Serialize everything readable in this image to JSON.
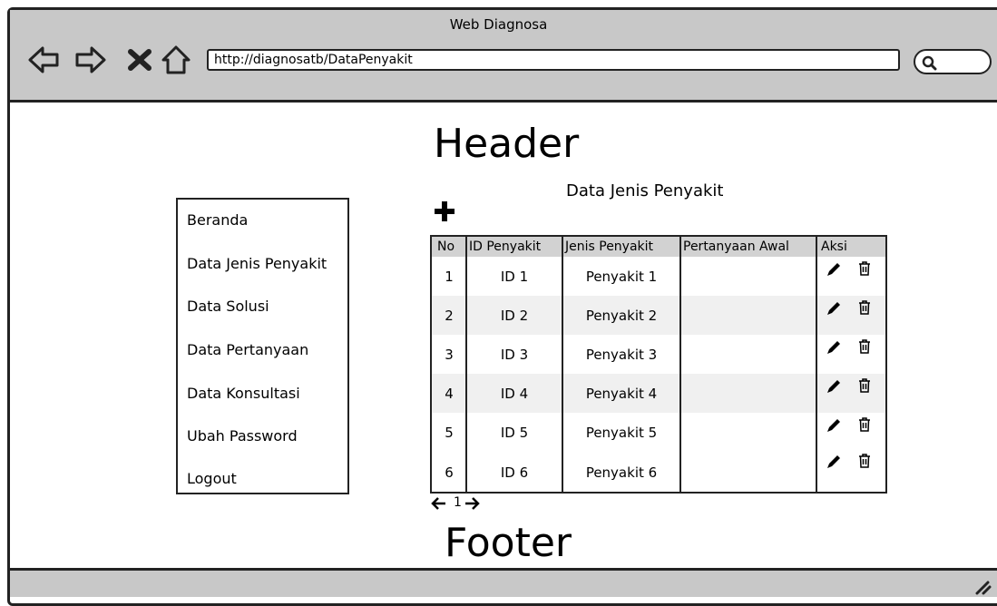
{
  "window": {
    "title": "Web Diagnosa",
    "url": "http://diagnosatb/DataPenyakit"
  },
  "page": {
    "header": "Header",
    "footer": "Footer",
    "section_title": "Data Jenis Penyakit"
  },
  "sidebar": {
    "items": [
      {
        "label": "Beranda"
      },
      {
        "label": "Data Jenis Penyakit"
      },
      {
        "label": "Data Solusi"
      },
      {
        "label": "Data Pertanyaan"
      },
      {
        "label": "Data Konsultasi"
      },
      {
        "label": "Ubah Password"
      },
      {
        "label": "Logout"
      }
    ]
  },
  "table": {
    "columns": [
      "No",
      "ID Penyakit",
      "Jenis Penyakit",
      "Pertanyaan Awal",
      "Aksi"
    ],
    "rows": [
      {
        "no": "1",
        "id": "ID 1",
        "jenis": "Penyakit 1",
        "pertanyaan": ""
      },
      {
        "no": "2",
        "id": "ID 2",
        "jenis": "Penyakit 2",
        "pertanyaan": ""
      },
      {
        "no": "3",
        "id": "ID 3",
        "jenis": "Penyakit 3",
        "pertanyaan": ""
      },
      {
        "no": "4",
        "id": "ID 4",
        "jenis": "Penyakit 4",
        "pertanyaan": ""
      },
      {
        "no": "5",
        "id": "ID 5",
        "jenis": "Penyakit 5",
        "pertanyaan": ""
      },
      {
        "no": "6",
        "id": "ID 6",
        "jenis": "Penyakit 6",
        "pertanyaan": ""
      }
    ],
    "actions": {
      "edit_icon": "pencil-icon",
      "delete_icon": "trash-icon"
    }
  },
  "pagination": {
    "current_page": "1",
    "prev_icon": "arrow-left-icon",
    "next_icon": "arrow-right-icon"
  },
  "icons": {
    "back": "arrow-left-icon",
    "forward": "arrow-right-icon",
    "stop": "close-icon",
    "home": "home-icon",
    "search": "search-icon",
    "add": "plus-icon",
    "resize": "resize-grip-icon"
  },
  "colors": {
    "chrome": "#c8c8c8",
    "table_header": "#d2d2d2",
    "row_alt": "#f0f0f0",
    "border": "#222222"
  }
}
